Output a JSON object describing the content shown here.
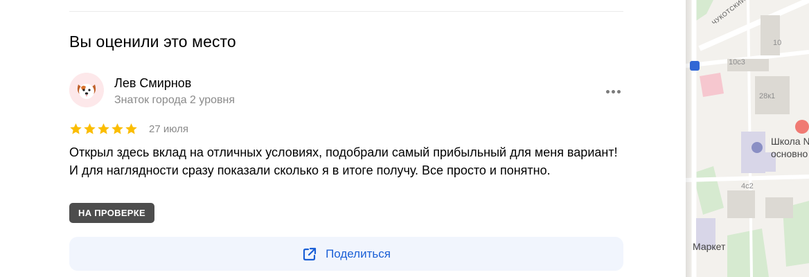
{
  "section": {
    "title": "Вы оценили это место"
  },
  "review": {
    "author_name": "Лев Смирнов",
    "author_level": "Знаток города 2 уровня",
    "rating": 5,
    "rating_max": 5,
    "date": "27 июля",
    "text": "Открыл здесь вклад на отличных условиях, подобрали самый прибыльный для меня вариант! И для наглядности сразу показали сколько я в итоге получу. Все просто и понятно.",
    "status_badge": "НА ПРОВЕРКЕ",
    "avatar_icon": "dog-avatar-icon",
    "more_icon": "more-dots-icon"
  },
  "share": {
    "label": "Поделиться",
    "icon": "share-icon"
  },
  "map": {
    "street": "ЧУКОТСКИЙ пр-д",
    "labels": [
      "10",
      "10с3",
      "28к1",
      "4с2"
    ],
    "poi_school": "Школа №",
    "poi_school_line2": "основно",
    "poi_market": "Маркет"
  },
  "colors": {
    "star": "#fbbd00",
    "accent": "#1a5fd6",
    "badge_bg": "#4d4d4d",
    "share_bg": "#f1f5fd"
  }
}
